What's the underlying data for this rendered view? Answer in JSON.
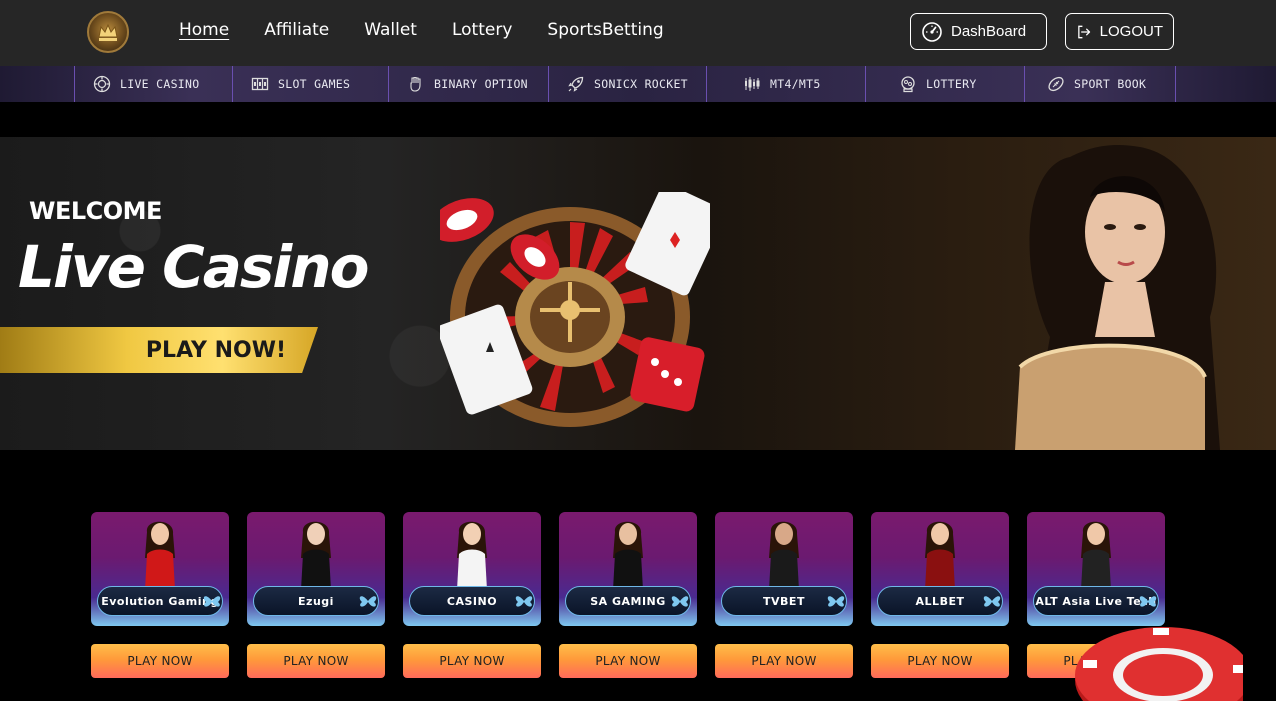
{
  "header": {
    "nav": [
      {
        "label": "Home",
        "active": true
      },
      {
        "label": "Affiliate"
      },
      {
        "label": "Wallet"
      },
      {
        "label": "Lottery"
      },
      {
        "label": "SportsBetting"
      }
    ],
    "dashboard_label": "DashBoard",
    "logout_label": "LOGOUT"
  },
  "categories": [
    {
      "label": "LIVE CASINO",
      "icon": "chip-icon",
      "width": 158
    },
    {
      "label": "SLOT GAMES",
      "icon": "slot-icon",
      "width": 156
    },
    {
      "label": "BINARY OPTION",
      "icon": "hand-icon",
      "width": 160
    },
    {
      "label": "SONICX ROCKET",
      "icon": "rocket-icon",
      "width": 158
    },
    {
      "label": "MT4/MT5",
      "icon": "candlestick-icon",
      "width": 159
    },
    {
      "label": "LOTTERY",
      "icon": "lottery-icon",
      "width": 159
    },
    {
      "label": "SPORT BOOK",
      "icon": "football-icon",
      "width": 152
    }
  ],
  "banner": {
    "welcome": "WELCOME",
    "title": "Live Casino",
    "cta": "PLAY NOW!"
  },
  "providers": [
    {
      "name": "Evolution Gaming",
      "play_label": "PLAY NOW"
    },
    {
      "name": "Ezugi",
      "play_label": "PLAY NOW"
    },
    {
      "name": "CASINO",
      "play_label": "PLAY NOW"
    },
    {
      "name": "SA GAMING",
      "play_label": "PLAY NOW"
    },
    {
      "name": "TVBET",
      "play_label": "PLAY NOW"
    },
    {
      "name": "ALLBET",
      "play_label": "PLAY NOW"
    },
    {
      "name": "ALT Asia Live Tech",
      "play_label": "PLAY NOW"
    }
  ],
  "colors": {
    "header_bg": "#262626",
    "category_border": "#6a4fb0",
    "play_button_top": "#ffbe4a",
    "play_button_bottom": "#ff6a5a"
  }
}
